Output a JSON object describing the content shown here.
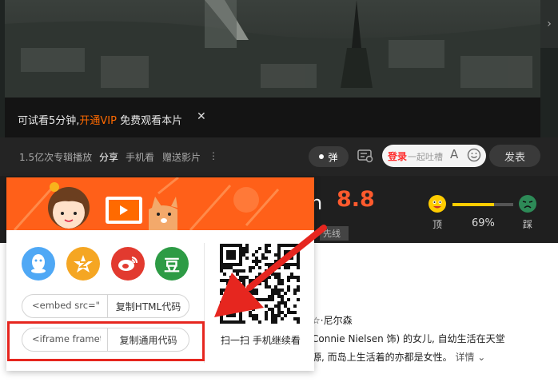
{
  "player": {
    "trial_prefix": "可试看5分钟,",
    "trial_vip": "开通VIP",
    "trial_suffix": " 免费观看本片",
    "trial_close": "✕",
    "next_arrow": "›"
  },
  "controls": {
    "items": [
      "1.5亿次专辑播放",
      "分享",
      "手机看",
      "赠送影片",
      "⋮"
    ],
    "danmu_label": "弹",
    "login": "登录",
    "comment_placeholder": "一起吐槽",
    "font_icon": "A",
    "send": "发表"
  },
  "info": {
    "title_tail": "n",
    "score": "8.8",
    "peek_text": "先线",
    "vote": {
      "up_label": "顶",
      "down_label": "踩",
      "percent": "69%",
      "fraction": 0.69
    }
  },
  "description": {
    "line1": "☆·尼尔森",
    "line2": "Connie Nielsen 饰) 的女儿, 自幼生活在天堂",
    "line3": "源, 而岛上生活着的亦都是女性。",
    "more": "详情"
  },
  "share": {
    "platforms": [
      {
        "name": "qq",
        "icon": "qq-icon"
      },
      {
        "name": "qzone",
        "icon": "qzone-icon"
      },
      {
        "name": "weibo",
        "icon": "weibo-icon"
      },
      {
        "name": "douban",
        "icon": "douban-icon",
        "glyph": "豆"
      }
    ],
    "embed_value": "<embed src=\"h",
    "embed_button": "复制HTML代码",
    "iframe_value": "<iframe framet",
    "iframe_button": "复制通用代码",
    "qr_caption": "扫一扫 手机继续看"
  },
  "colors": {
    "accent_orange": "#ff6a00",
    "banner": "#ff6019",
    "score": "#ff5a2d",
    "annotation_red": "#e6261f"
  }
}
